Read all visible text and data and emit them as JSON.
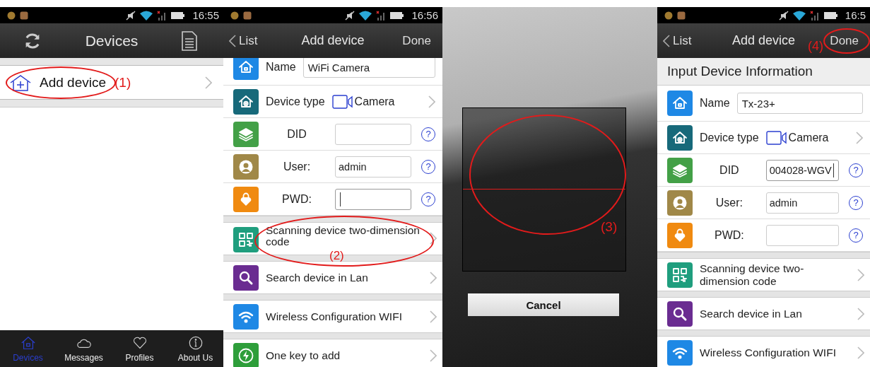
{
  "panels": [
    {
      "kind": "devices",
      "status": {
        "time": "16:55"
      },
      "nav": {
        "title": "Devices"
      },
      "items": [
        {
          "label": "Add device",
          "annotation": "(1)",
          "circled": true
        }
      ],
      "tabs": [
        {
          "label": "Devices",
          "selected": true
        },
        {
          "label": "Messages",
          "selected": false
        },
        {
          "label": "Profiles",
          "selected": false
        },
        {
          "label": "About Us",
          "selected": false
        }
      ]
    },
    {
      "kind": "form",
      "status": {
        "time": "16:56"
      },
      "nav": {
        "back": "List",
        "title": "Add device",
        "action": "Done",
        "action_circled": false
      },
      "scrolled": true,
      "fields": [
        {
          "kind": "text",
          "label": "Name",
          "value": "WiFi Camera",
          "color": "#1e88e5"
        },
        {
          "kind": "select",
          "label": "Device type",
          "value": "Camera",
          "color": "#17697a"
        },
        {
          "kind": "credential",
          "label": "DID",
          "help": "?",
          "focused": false,
          "color": "#43a047"
        },
        {
          "kind": "credential",
          "label": "User:",
          "value": "admin",
          "help": "?",
          "focused": false,
          "color": "#a08848"
        },
        {
          "kind": "credential",
          "label": "PWD:",
          "help": "?",
          "focused": true,
          "color": "#f08a10"
        }
      ],
      "actions": [
        {
          "label": "Scanning device two-dimension code",
          "color": "#1f9e7e",
          "circled": true,
          "annotation": "(2)"
        },
        {
          "label": "Search device in Lan",
          "color": "#6a2c91",
          "circled": false
        },
        {
          "label": "Wireless Configuration WIFI",
          "color": "#1e88e5",
          "circled": false
        },
        {
          "label": "One key to add",
          "color": "#2e9e3a",
          "circled": false
        }
      ]
    },
    {
      "kind": "camera",
      "cancel": "Cancel",
      "circled": true,
      "annotation": "(3)"
    },
    {
      "kind": "form",
      "status": {
        "time": "16:5"
      },
      "nav": {
        "back": "List",
        "title": "Add device",
        "action": "Done",
        "action_circled": true,
        "annotation": "(4)"
      },
      "scrolled": false,
      "section_title": "Input Device Information",
      "fields": [
        {
          "kind": "text",
          "label": "Name",
          "value": "Tx-23+",
          "color": "#1e88e5"
        },
        {
          "kind": "select",
          "label": "Device type",
          "value": "Camera",
          "color": "#17697a"
        },
        {
          "kind": "credential",
          "label": "DID",
          "value": "004028-WGV",
          "help": "?",
          "focused": true,
          "color": "#43a047"
        },
        {
          "kind": "credential",
          "label": "User:",
          "value": "admin",
          "help": "?",
          "focused": false,
          "color": "#a08848"
        },
        {
          "kind": "credential",
          "label": "PWD:",
          "help": "?",
          "focused": false,
          "color": "#f08a10"
        }
      ],
      "actions": [
        {
          "label": "Scanning device two-dimension code",
          "color": "#1f9e7e",
          "circled": false
        },
        {
          "label": "Search device in Lan",
          "color": "#6a2c91",
          "circled": false
        },
        {
          "label": "Wireless Configuration WIFI",
          "color": "#1e88e5",
          "circled": false
        }
      ]
    }
  ]
}
